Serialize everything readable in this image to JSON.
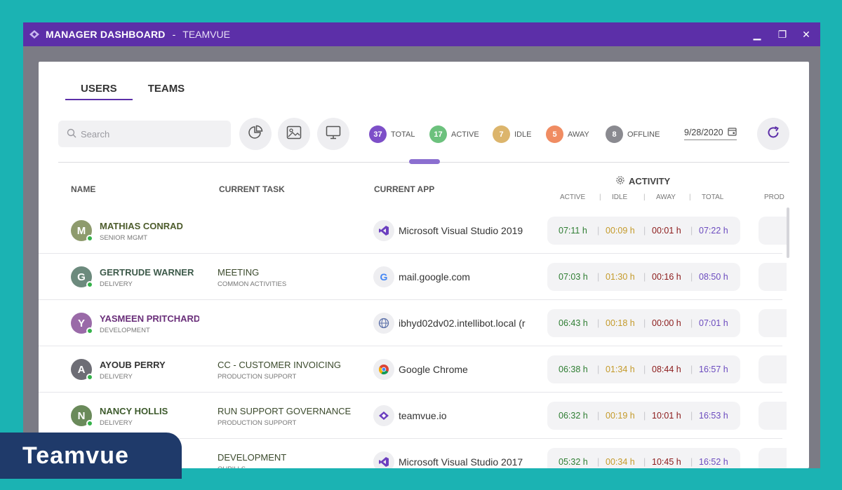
{
  "window": {
    "app_title": "MANAGER DASHBOARD",
    "separator": "-",
    "subtitle": "TEAMVUE",
    "controls": {
      "minimize": "▁",
      "maximize": "❐",
      "close": "✕"
    }
  },
  "tabs": [
    {
      "label": "USERS",
      "active": true
    },
    {
      "label": "TEAMS",
      "active": false
    }
  ],
  "toolbar": {
    "search_placeholder": "Search",
    "icons": [
      "pie-chart-icon",
      "image-icon",
      "monitor-icon"
    ],
    "stats": [
      {
        "count": "37",
        "label": "TOTAL",
        "color": "#7d4fc8"
      },
      {
        "count": "17",
        "label": "ACTIVE",
        "color": "#6cc17d"
      },
      {
        "count": "7",
        "label": "IDLE",
        "color": "#dcb56c"
      },
      {
        "count": "5",
        "label": "AWAY",
        "color": "#f08c62"
      },
      {
        "count": "8",
        "label": "OFFLINE",
        "color": "#8a8a90"
      }
    ],
    "date": "9/28/2020"
  },
  "table": {
    "headers": {
      "name": "NAME",
      "task": "CURRENT TASK",
      "app": "CURRENT APP",
      "activity": "ACTIVITY",
      "active": "ACTIVE",
      "idle": "IDLE",
      "away": "AWAY",
      "total": "TOTAL",
      "prod": "PROD"
    },
    "colors": {
      "active": "#2e7d32",
      "idle": "#c49a2a",
      "away": "#8b1a1a",
      "total": "#6b4bbf"
    },
    "rows": [
      {
        "initial": "M",
        "avatar_color": "#8e9b6d",
        "name": "MATHIAS CONRAD",
        "name_color": "#4d5c2c",
        "dept": "SENIOR MGMT",
        "task": "",
        "task_sub": "",
        "app_icon": "vs",
        "app": "Microsoft Visual Studio 2019",
        "active": "07:11 h",
        "idle": "00:09 h",
        "away": "00:01 h",
        "total": "07:22 h"
      },
      {
        "initial": "G",
        "avatar_color": "#6c8a7d",
        "name": "GERTRUDE WARNER",
        "name_color": "#3d5a4a",
        "dept": "DELIVERY",
        "task": "MEETING",
        "task_sub": "COMMON ACTIVITIES",
        "app_icon": "google",
        "app": "mail.google.com",
        "active": "07:03 h",
        "idle": "01:30 h",
        "away": "00:16 h",
        "total": "08:50 h"
      },
      {
        "initial": "Y",
        "avatar_color": "#9a6aa8",
        "name": "YASMEEN PRITCHARD",
        "name_color": "#6a2f7a",
        "dept": "DEVELOPMENT",
        "task": "",
        "task_sub": "",
        "app_icon": "globe",
        "app": "ibhyd02dv02.intellibot.local (r",
        "active": "06:43 h",
        "idle": "00:18 h",
        "away": "00:00 h",
        "total": "07:01 h"
      },
      {
        "initial": "A",
        "avatar_color": "#6d6d75",
        "name": "AYOUB PERRY",
        "name_color": "#333",
        "dept": "DELIVERY",
        "task": "CC - CUSTOMER INVOICING",
        "task_sub": "PRODUCTION SUPPORT",
        "app_icon": "chrome",
        "app": "Google Chrome",
        "active": "06:38 h",
        "idle": "01:34 h",
        "away": "08:44 h",
        "total": "16:57 h"
      },
      {
        "initial": "N",
        "avatar_color": "#6a8a5a",
        "name": "NANCY HOLLIS",
        "name_color": "#3d5a2c",
        "dept": "DELIVERY",
        "task": "RUN SUPPORT GOVERNANCE",
        "task_sub": "PRODUCTION SUPPORT",
        "app_icon": "teamvue",
        "app": "teamvue.io",
        "active": "06:32 h",
        "idle": "00:19 h",
        "away": "10:01 h",
        "total": "16:53 h"
      },
      {
        "initial": "",
        "avatar_color": "#ffffff",
        "name": "",
        "name_color": "#333",
        "dept": "",
        "task": "DEVELOPMENT",
        "task_sub": "QUPILLS",
        "app_icon": "vs",
        "app": "Microsoft Visual Studio 2017",
        "active": "05:32 h",
        "idle": "00:34 h",
        "away": "10:45 h",
        "total": "16:52 h"
      }
    ]
  },
  "brand": {
    "label": "Teamvue"
  }
}
